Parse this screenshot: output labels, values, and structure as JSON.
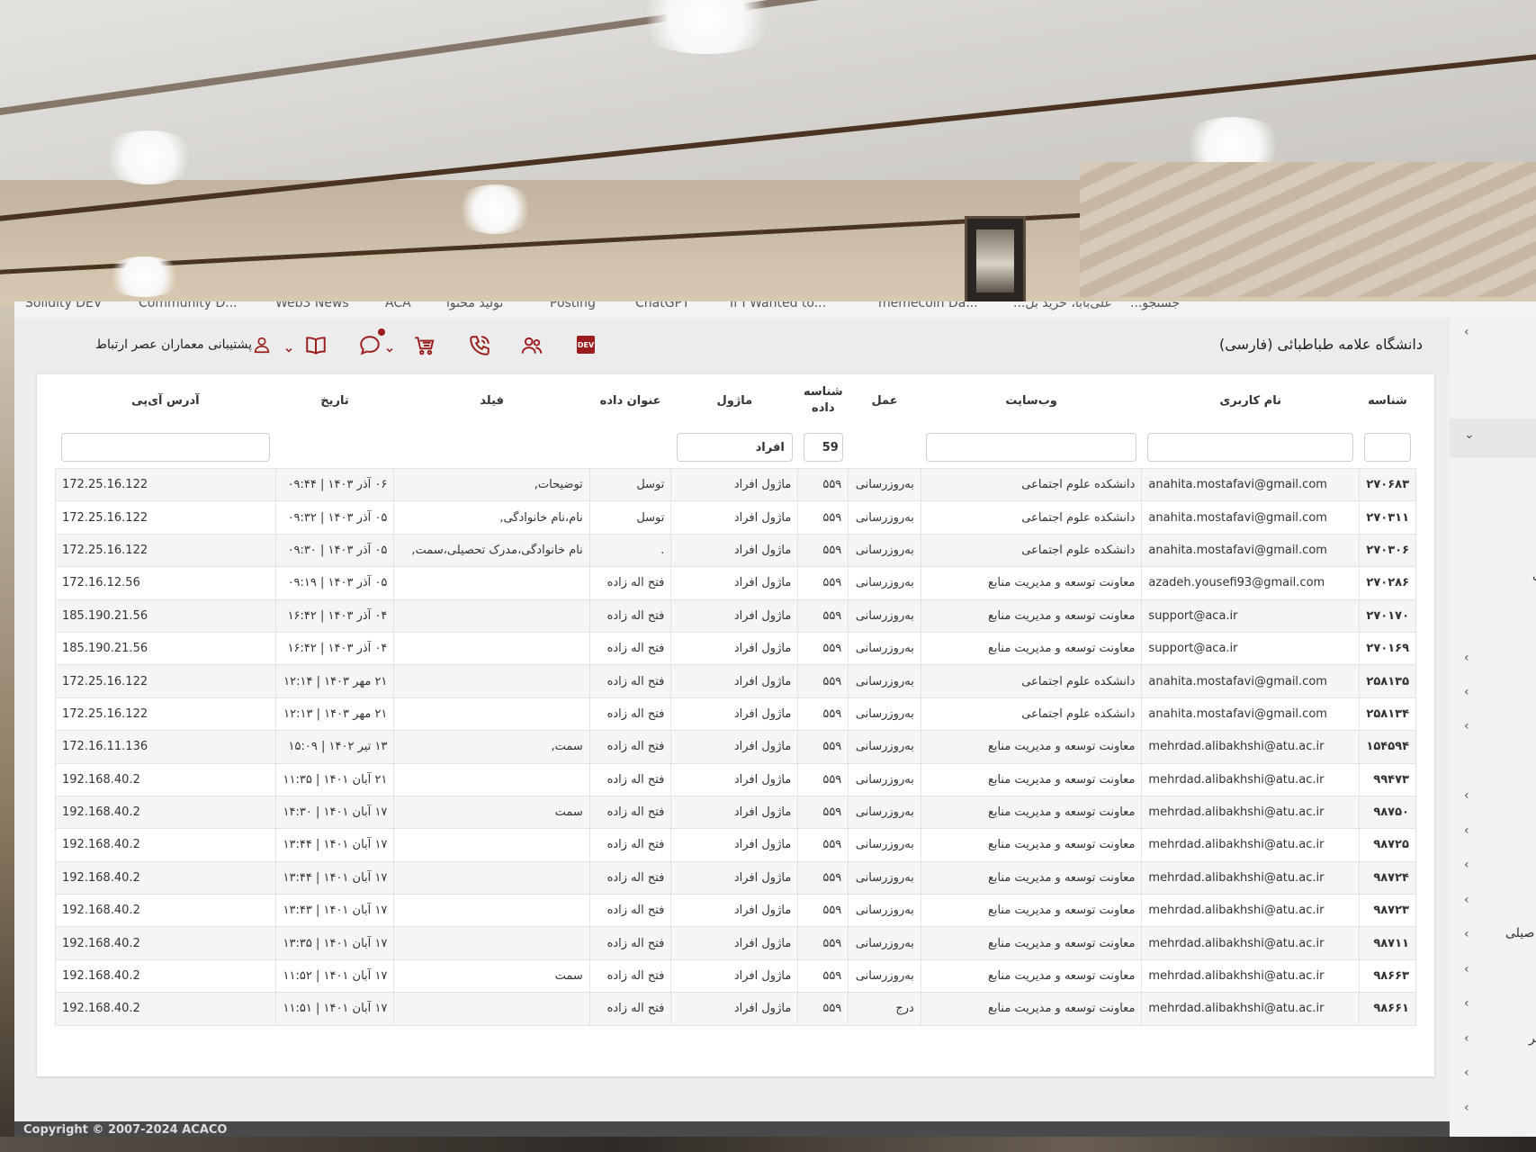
{
  "bookmarks": [
    "Solidity DEV",
    "Community D...",
    "Web3 News",
    "ACA",
    "تولید محتوا",
    "Posting",
    "ChatGPT",
    "If I Wanted to...",
    "memecoin Da...",
    "...علی‌بابا، خرید بل",
    "...جستجو"
  ],
  "header": {
    "site_title": "دانشگاه علامه طباطبائی (فارسی)",
    "dev_label": "DEV",
    "user_name": "پشتیبانی معماران عصر ارتباط"
  },
  "sidebar": {
    "texts": [
      "ی",
      "صیلی",
      "یر"
    ]
  },
  "table": {
    "headers": {
      "id": "شناسه",
      "username": "نام کاربری",
      "website": "وب‌سایت",
      "action": "عمل",
      "data_id": "شناسه داده",
      "module": "ماژول",
      "data_title": "عنوان داده",
      "field": "فیلد",
      "date": "تاریخ",
      "ip": "آدرس آی‌پی"
    },
    "filters": {
      "id": "",
      "username": "",
      "website": "",
      "data_id": "59",
      "module": "افراد",
      "ip": ""
    },
    "rows": [
      {
        "id": "۲۷۰۶۸۳",
        "user": "anahita.mostafavi@gmail.com",
        "site": "دانشکده علوم اجتماعی",
        "action": "به‌روزرسانی",
        "data_id": "۵۵۹",
        "module": "ماژول افراد",
        "title": "توسل",
        "field": "توضیحات,",
        "date": "۰۶ آذر ۱۴۰۳ | ۰۹:۴۴",
        "ip": "172.25.16.122"
      },
      {
        "id": "۲۷۰۳۱۱",
        "user": "anahita.mostafavi@gmail.com",
        "site": "دانشکده علوم اجتماعی",
        "action": "به‌روزرسانی",
        "data_id": "۵۵۹",
        "module": "ماژول افراد",
        "title": "توسل",
        "field": "نام،نام خانوادگی,",
        "date": "۰۵ آذر ۱۴۰۳ | ۰۹:۳۲",
        "ip": "172.25.16.122"
      },
      {
        "id": "۲۷۰۳۰۶",
        "user": "anahita.mostafavi@gmail.com",
        "site": "دانشکده علوم اجتماعی",
        "action": "به‌روزرسانی",
        "data_id": "۵۵۹",
        "module": "ماژول افراد",
        "title": ".",
        "field": "نام خانوادگی،مدرک تحصیلی،سمت,",
        "date": "۰۵ آذر ۱۴۰۳ | ۰۹:۳۰",
        "ip": "172.25.16.122"
      },
      {
        "id": "۲۷۰۲۸۶",
        "user": "azadeh.yousefi93@gmail.com",
        "site": "معاونت توسعه و مدیریت منابع",
        "action": "به‌روزرسانی",
        "data_id": "۵۵۹",
        "module": "ماژول افراد",
        "title": "فتح اله زاده",
        "field": "",
        "date": "۰۵ آذر ۱۴۰۳ | ۰۹:۱۹",
        "ip": "172.16.12.56"
      },
      {
        "id": "۲۷۰۱۷۰",
        "user": "support@aca.ir",
        "site": "معاونت توسعه و مدیریت منابع",
        "action": "به‌روزرسانی",
        "data_id": "۵۵۹",
        "module": "ماژول افراد",
        "title": "فتح اله زاده",
        "field": "",
        "date": "۰۴ آذر ۱۴۰۳ | ۱۶:۴۲",
        "ip": "185.190.21.56"
      },
      {
        "id": "۲۷۰۱۶۹",
        "user": "support@aca.ir",
        "site": "معاونت توسعه و مدیریت منابع",
        "action": "به‌روزرسانی",
        "data_id": "۵۵۹",
        "module": "ماژول افراد",
        "title": "فتح اله زاده",
        "field": "",
        "date": "۰۴ آذر ۱۴۰۳ | ۱۶:۴۲",
        "ip": "185.190.21.56"
      },
      {
        "id": "۲۵۸۱۳۵",
        "user": "anahita.mostafavi@gmail.com",
        "site": "دانشکده علوم اجتماعی",
        "action": "به‌روزرسانی",
        "data_id": "۵۵۹",
        "module": "ماژول افراد",
        "title": "فتح اله زاده",
        "field": "",
        "date": "۲۱ مهر ۱۴۰۳ | ۱۲:۱۴",
        "ip": "172.25.16.122"
      },
      {
        "id": "۲۵۸۱۳۴",
        "user": "anahita.mostafavi@gmail.com",
        "site": "دانشکده علوم اجتماعی",
        "action": "به‌روزرسانی",
        "data_id": "۵۵۹",
        "module": "ماژول افراد",
        "title": "فتح اله زاده",
        "field": "",
        "date": "۲۱ مهر ۱۴۰۳ | ۱۲:۱۳",
        "ip": "172.25.16.122"
      },
      {
        "id": "۱۵۴۵۹۴",
        "user": "mehrdad.alibakhshi@atu.ac.ir",
        "site": "معاونت توسعه و مدیریت منابع",
        "action": "به‌روزرسانی",
        "data_id": "۵۵۹",
        "module": "ماژول افراد",
        "title": "فتح اله زاده",
        "field": "سمت,",
        "date": "۱۳ تیر ۱۴۰۲ | ۱۵:۰۹",
        "ip": "172.16.11.136"
      },
      {
        "id": "۹۹۴۷۳",
        "user": "mehrdad.alibakhshi@atu.ac.ir",
        "site": "معاونت توسعه و مدیریت منابع",
        "action": "به‌روزرسانی",
        "data_id": "۵۵۹",
        "module": "ماژول افراد",
        "title": "فتح اله زاده",
        "field": "",
        "date": "۲۱ آبان ۱۴۰۱ | ۱۱:۳۵",
        "ip": "192.168.40.2"
      },
      {
        "id": "۹۸۷۵۰",
        "user": "mehrdad.alibakhshi@atu.ac.ir",
        "site": "معاونت توسعه و مدیریت منابع",
        "action": "به‌روزرسانی",
        "data_id": "۵۵۹",
        "module": "ماژول افراد",
        "title": "فتح اله زاده",
        "field": "سمت",
        "date": "۱۷ آبان ۱۴۰۱ | ۱۴:۳۰",
        "ip": "192.168.40.2"
      },
      {
        "id": "۹۸۷۲۵",
        "user": "mehrdad.alibakhshi@atu.ac.ir",
        "site": "معاونت توسعه و مدیریت منابع",
        "action": "به‌روزرسانی",
        "data_id": "۵۵۹",
        "module": "ماژول افراد",
        "title": "فتح اله زاده",
        "field": "",
        "date": "۱۷ آبان ۱۴۰۱ | ۱۳:۴۴",
        "ip": "192.168.40.2"
      },
      {
        "id": "۹۸۷۲۴",
        "user": "mehrdad.alibakhshi@atu.ac.ir",
        "site": "معاونت توسعه و مدیریت منابع",
        "action": "به‌روزرسانی",
        "data_id": "۵۵۹",
        "module": "ماژول افراد",
        "title": "فتح اله زاده",
        "field": "",
        "date": "۱۷ آبان ۱۴۰۱ | ۱۳:۴۴",
        "ip": "192.168.40.2"
      },
      {
        "id": "۹۸۷۲۳",
        "user": "mehrdad.alibakhshi@atu.ac.ir",
        "site": "معاونت توسعه و مدیریت منابع",
        "action": "به‌روزرسانی",
        "data_id": "۵۵۹",
        "module": "ماژول افراد",
        "title": "فتح اله زاده",
        "field": "",
        "date": "۱۷ آبان ۱۴۰۱ | ۱۳:۴۳",
        "ip": "192.168.40.2"
      },
      {
        "id": "۹۸۷۱۱",
        "user": "mehrdad.alibakhshi@atu.ac.ir",
        "site": "معاونت توسعه و مدیریت منابع",
        "action": "به‌روزرسانی",
        "data_id": "۵۵۹",
        "module": "ماژول افراد",
        "title": "فتح اله زاده",
        "field": "",
        "date": "۱۷ آبان ۱۴۰۱ | ۱۳:۳۵",
        "ip": "192.168.40.2"
      },
      {
        "id": "۹۸۶۶۳",
        "user": "mehrdad.alibakhshi@atu.ac.ir",
        "site": "معاونت توسعه و مدیریت منابع",
        "action": "به‌روزرسانی",
        "data_id": "۵۵۹",
        "module": "ماژول افراد",
        "title": "فتح اله زاده",
        "field": "سمت",
        "date": "۱۷ آبان ۱۴۰۱ | ۱۱:۵۲",
        "ip": "192.168.40.2"
      },
      {
        "id": "۹۸۶۶۱",
        "user": "mehrdad.alibakhshi@atu.ac.ir",
        "site": "معاونت توسعه و مدیریت منابع",
        "action": "درج",
        "data_id": "۵۵۹",
        "module": "ماژول افراد",
        "title": "فتح اله زاده",
        "field": "",
        "date": "۱۷ آبان ۱۴۰۱ | ۱۱:۵۱",
        "ip": "192.168.40.2"
      }
    ]
  },
  "footer": {
    "copyright": "Copyright © 2007-2024 ACACO"
  },
  "colors": {
    "accent": "#9b1c1c",
    "header_bg": "#ececec",
    "row_stripe": "#f5f5f5"
  },
  "icons": [
    "dev-badge-icon",
    "people-icon",
    "phone-icon",
    "cart-icon",
    "chat-icon",
    "book-icon",
    "user-icon",
    "chevron-down-icon",
    "chevron-left-icon"
  ]
}
